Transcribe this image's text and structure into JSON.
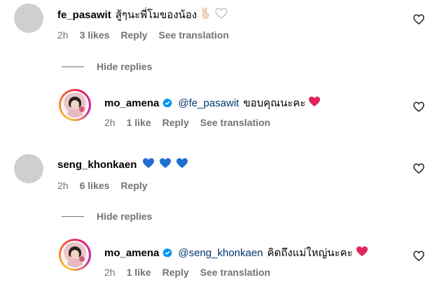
{
  "comments": [
    {
      "username": "fe_pasawit",
      "text": "สู้ๆนะพี่โมของน้อง",
      "emojis": [
        "victory-hand",
        "white-heart"
      ],
      "time": "2h",
      "likes": "3 likes",
      "reply": "Reply",
      "translate": "See translation",
      "hide_replies": "Hide replies",
      "replies": [
        {
          "username": "mo_amena",
          "mention": "@fe_pasawit",
          "text": "ขอบคุณนะคะ",
          "emoji": "red-heart",
          "time": "2h",
          "likes": "1 like",
          "reply": "Reply",
          "translate": "See translation"
        }
      ]
    },
    {
      "username": "seng_khonkaen",
      "emojis": [
        "blue-heart",
        "blue-heart",
        "blue-heart"
      ],
      "time": "2h",
      "likes": "6 likes",
      "reply": "Reply",
      "hide_replies": "Hide replies",
      "replies": [
        {
          "username": "mo_amena",
          "mention": "@seng_khonkaen",
          "text": "คิดถึงแม่ใหญ่นะคะ",
          "emoji": "red-heart",
          "time": "2h",
          "likes": "1 like",
          "reply": "Reply",
          "translate": "See translation"
        }
      ]
    }
  ],
  "colors": {
    "secondary_text": "#737373",
    "mention": "#00376b",
    "verified": "#0095f6",
    "red_heart": "#e0245e",
    "blue_heart": "#1f6fd1"
  }
}
